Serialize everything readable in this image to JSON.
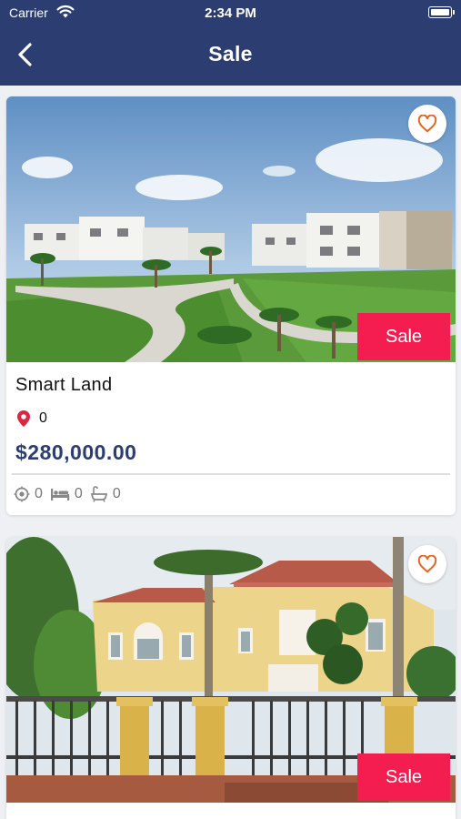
{
  "status_bar": {
    "carrier": "Carrier",
    "time": "2:34 PM"
  },
  "nav": {
    "title": "Sale"
  },
  "colors": {
    "nav_bg": "#2c3d72",
    "sale_badge": "#f41d4f",
    "favorite_icon": "#e8641f",
    "location_pin": "#e0233f",
    "price_text": "#2c3d72"
  },
  "listings": [
    {
      "badge": "Sale",
      "title": "Smart Land",
      "location": "0",
      "price": "$280,000.00",
      "area": "0",
      "beds": "0",
      "baths": "0",
      "icons": [
        "heart-outline-icon",
        "map-pin-icon",
        "area-target-icon",
        "bed-icon",
        "bathtub-icon"
      ]
    },
    {
      "badge": "Sale",
      "icons": [
        "heart-outline-icon"
      ]
    }
  ]
}
